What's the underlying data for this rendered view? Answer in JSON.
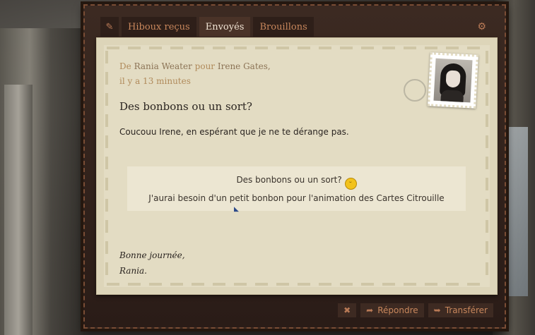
{
  "tabs": {
    "edit_icon": "pencil-icon",
    "items": [
      {
        "label": "Hiboux reçus"
      },
      {
        "label": "Envoyés"
      },
      {
        "label": "Brouillons"
      }
    ]
  },
  "settings_icon": "gear-icon",
  "letter": {
    "from_prefix": "De",
    "sender": "Rania Weater",
    "to_prefix": "pour",
    "recipient": "Irene Gates,",
    "time": "il y a 13 minutes",
    "subject": "Des bonbons ou un sort?",
    "greeting": "Coucouu Irene, en espérant que je ne te dérange pas.",
    "quote_line1": "Des bonbons ou un sort?",
    "quote_line2": "J'aurai besoin d'un petit bonbon pour l'animation des Cartes Citrouille",
    "closing1": "Bonne journée,",
    "closing2": "Rania."
  },
  "actions": {
    "close_label": "",
    "reply_label": "Répondre",
    "forward_label": "Transférer"
  }
}
